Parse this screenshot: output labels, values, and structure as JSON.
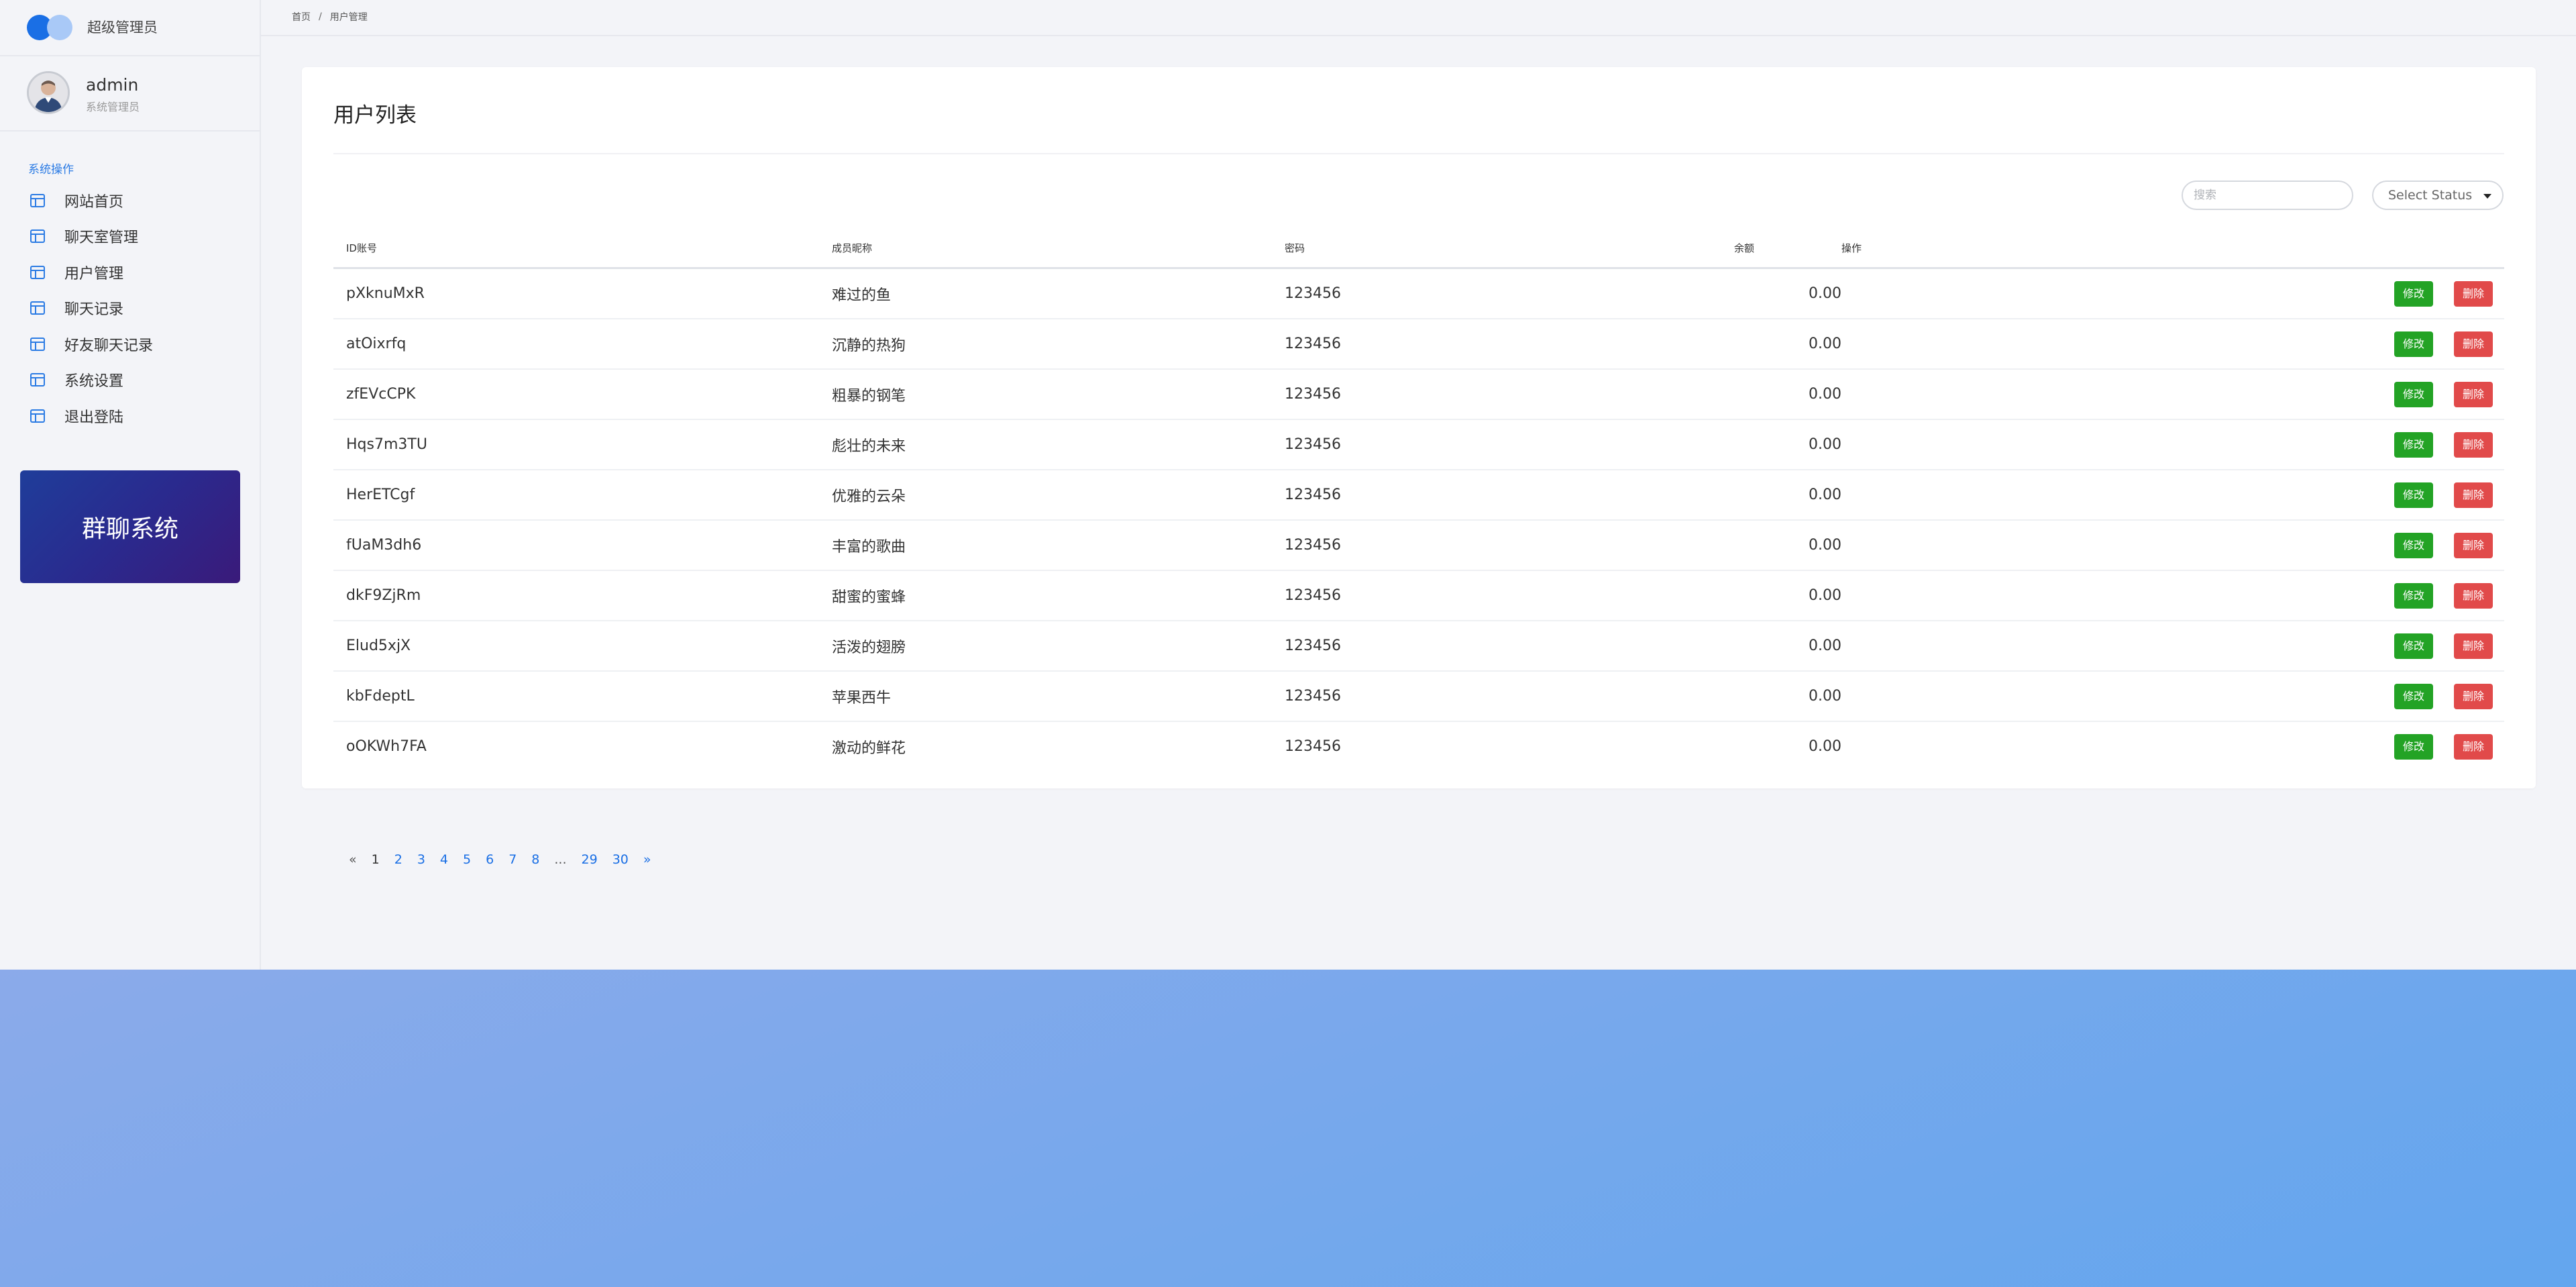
{
  "brand": {
    "name": "超级管理员"
  },
  "user": {
    "name": "admin",
    "role": "系统管理员"
  },
  "nav": {
    "section": "系统操作",
    "items": [
      {
        "label": "网站首页"
      },
      {
        "label": "聊天室管理"
      },
      {
        "label": "用户管理"
      },
      {
        "label": "聊天记录"
      },
      {
        "label": "好友聊天记录"
      },
      {
        "label": "系统设置"
      },
      {
        "label": "退出登陆"
      }
    ],
    "icon_color": "#2b7be4"
  },
  "promo": {
    "label": "群聊系统"
  },
  "breadcrumb": {
    "home": "首页",
    "separator": "/",
    "current": "用户管理"
  },
  "card": {
    "title": "用户列表"
  },
  "filters": {
    "search_placeholder": "搜索",
    "status_label": "Select Status"
  },
  "table": {
    "headers": {
      "id": "ID账号",
      "nick": "成员昵称",
      "password": "密码",
      "balance": "余额",
      "ops": "操作"
    },
    "edit_label": "修改",
    "delete_label": "删除",
    "rows": [
      {
        "id": "pXknuMxR",
        "nick": "难过的鱼",
        "password": "123456",
        "balance": "0.00"
      },
      {
        "id": "atOixrfq",
        "nick": "沉静的热狗",
        "password": "123456",
        "balance": "0.00"
      },
      {
        "id": "zfEVcCPK",
        "nick": "粗暴的钢笔",
        "password": "123456",
        "balance": "0.00"
      },
      {
        "id": "Hqs7m3TU",
        "nick": "彪壮的未来",
        "password": "123456",
        "balance": "0.00"
      },
      {
        "id": "HerETCgf",
        "nick": "优雅的云朵",
        "password": "123456",
        "balance": "0.00"
      },
      {
        "id": "fUaM3dh6",
        "nick": "丰富的歌曲",
        "password": "123456",
        "balance": "0.00"
      },
      {
        "id": "dkF9ZjRm",
        "nick": "甜蜜的蜜蜂",
        "password": "123456",
        "balance": "0.00"
      },
      {
        "id": "Elud5xjX",
        "nick": "活泼的翅膀",
        "password": "123456",
        "balance": "0.00"
      },
      {
        "id": "kbFdeptL",
        "nick": "苹果西牛",
        "password": "123456",
        "balance": "0.00"
      },
      {
        "id": "oOKWh7FA",
        "nick": "激动的鲜花",
        "password": "123456",
        "balance": "0.00"
      }
    ]
  },
  "pagination": {
    "prev": "«",
    "pages": [
      "1",
      "2",
      "3",
      "4",
      "5",
      "6",
      "7",
      "8",
      "...",
      "29",
      "30"
    ],
    "current": "1",
    "next": "»"
  },
  "colors": {
    "accent": "#1a6fe5",
    "edit": "#23a325",
    "delete": "#e14a4a",
    "background_gradient": [
      "#a9b0ea",
      "#63a6ee"
    ]
  }
}
